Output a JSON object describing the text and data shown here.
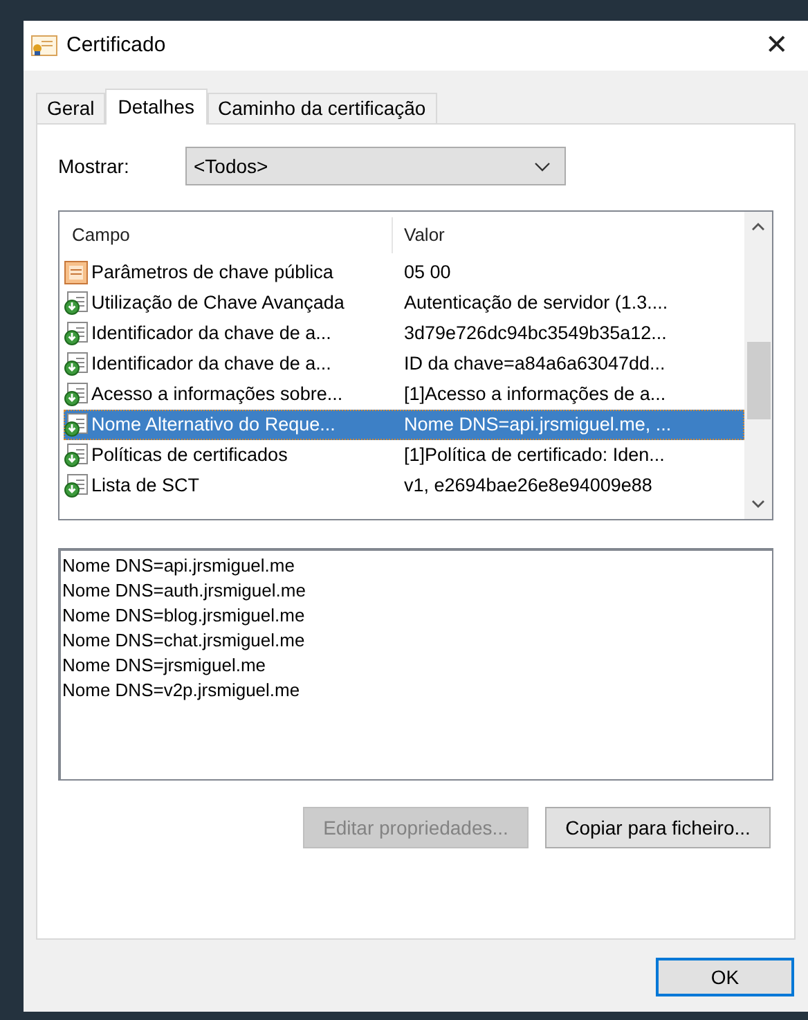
{
  "window": {
    "title": "Certificado",
    "close": "✕"
  },
  "tabs": [
    {
      "label": "Geral",
      "selected": false
    },
    {
      "label": "Detalhes",
      "selected": true
    },
    {
      "label": "Caminho da certificação",
      "selected": false
    }
  ],
  "show": {
    "label": "Mostrar:",
    "value": "<Todos>"
  },
  "table": {
    "columns": [
      "Campo",
      "Valor"
    ],
    "rows": [
      {
        "kind": "property",
        "field": "Parâmetros de chave pública",
        "value": "05 00",
        "selected": false
      },
      {
        "kind": "extension",
        "field": "Utilização de Chave Avançada",
        "value": "Autenticação de servidor (1.3....",
        "selected": false
      },
      {
        "kind": "extension",
        "field": "Identificador da chave de a...",
        "value": "3d79e726dc94bc3549b35a12...",
        "selected": false
      },
      {
        "kind": "extension",
        "field": "Identificador da chave de a...",
        "value": "ID da chave=a84a6a63047dd...",
        "selected": false
      },
      {
        "kind": "extension",
        "field": "Acesso a informações sobre...",
        "value": "[1]Acesso a informações de a...",
        "selected": false
      },
      {
        "kind": "extension",
        "field": "Nome Alternativo do Reque...",
        "value": "Nome DNS=api.jrsmiguel.me, ...",
        "selected": true
      },
      {
        "kind": "extension",
        "field": "Políticas de certificados",
        "value": "[1]Política de certificado: Iden...",
        "selected": false
      },
      {
        "kind": "extension",
        "field": "Lista de SCT",
        "value": "v1, e2694bae26e8e94009e88",
        "selected": false
      }
    ]
  },
  "detail_lines": [
    "Nome DNS=api.jrsmiguel.me",
    "Nome DNS=auth.jrsmiguel.me",
    "Nome DNS=blog.jrsmiguel.me",
    "Nome DNS=chat.jrsmiguel.me",
    "Nome DNS=jrsmiguel.me",
    "Nome DNS=v2p.jrsmiguel.me"
  ],
  "buttons": [
    {
      "label": "Editar propriedades...",
      "disabled": true
    },
    {
      "label": "Copiar para ficheiro...",
      "disabled": false
    }
  ],
  "ok_button": {
    "label": "OK"
  }
}
